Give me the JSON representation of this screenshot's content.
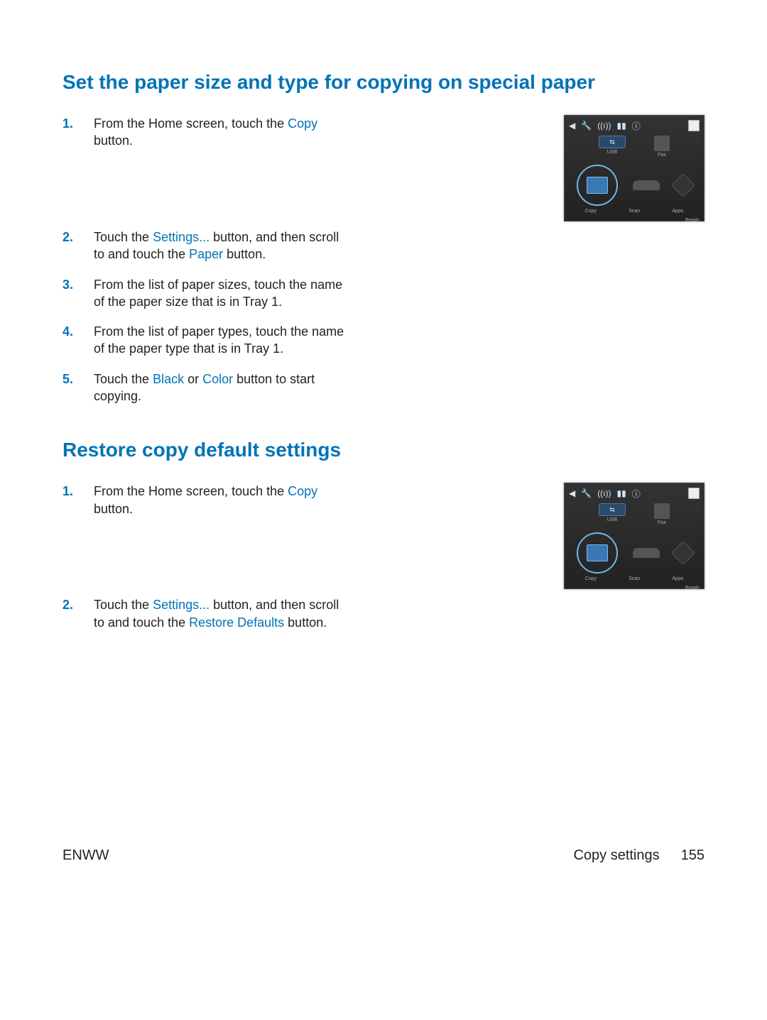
{
  "section1": {
    "heading": "Set the paper size and type for copying on special paper",
    "steps": [
      {
        "num": "1.",
        "pre": "From the Home screen, touch the ",
        "link": "Copy",
        "post": " button."
      },
      {
        "num": "2.",
        "pre": "Touch the ",
        "link": "Settings...",
        "mid": " button, and then scroll to and touch the ",
        "link2": "Paper",
        "post": " button."
      },
      {
        "num": "3.",
        "text": "From the list of paper sizes, touch the name of the paper size that is in Tray 1."
      },
      {
        "num": "4.",
        "text": "From the list of paper types, touch the name of the paper type that is in Tray 1."
      },
      {
        "num": "5.",
        "pre": "Touch the ",
        "link": "Black",
        "mid": " or ",
        "link2": "Color",
        "post": " button to start copying."
      }
    ]
  },
  "section2": {
    "heading": "Restore copy default settings",
    "steps": [
      {
        "num": "1.",
        "pre": "From the Home screen, touch the ",
        "link": "Copy",
        "post": " button."
      },
      {
        "num": "2.",
        "pre": "Touch the ",
        "link": "Settings...",
        "mid": " button, and then scroll to and touch the ",
        "link2": "Restore Defaults",
        "post": " button."
      }
    ]
  },
  "panel": {
    "usb": "USB",
    "fax": "Fax",
    "copy": "Copy",
    "scan": "Scan",
    "apps": "Apps",
    "ready": "Ready"
  },
  "footer": {
    "left": "ENWW",
    "section": "Copy settings",
    "page": "155"
  }
}
